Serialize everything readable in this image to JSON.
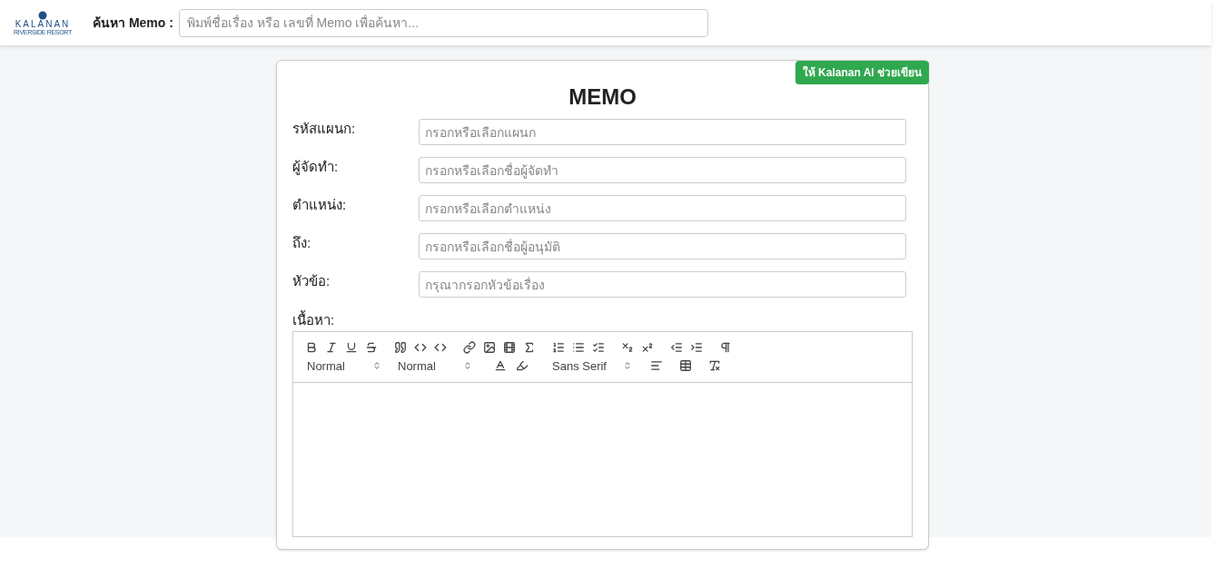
{
  "header": {
    "logo": {
      "name": "KALANAN",
      "tagline": "RIVERSIDE RESORT"
    },
    "search": {
      "label": "ค้นหา Memo :",
      "placeholder": "พิมพ์ชื่อเรื่อง หรือ เลขที่ Memo เพื่อค้นหา..."
    }
  },
  "memo": {
    "ai_button": "ให้ Kalanan AI ช่วยเขียน",
    "title": "MEMO",
    "fields": [
      {
        "label": "รหัสแผนก:",
        "placeholder": "กรอกหรือเลือกแผนก"
      },
      {
        "label": "ผู้จัดทำ:",
        "placeholder": "กรอกหรือเลือกชื่อผู้จัดทำ"
      },
      {
        "label": "ตำแหน่ง:",
        "placeholder": "กรอกหรือเลือกตำแหน่ง"
      },
      {
        "label": "ถึง:",
        "placeholder": "กรอกหรือเลือกชื่อผู้อนุมัติ"
      },
      {
        "label": "หัวข้อ:",
        "placeholder": "กรุณากรอกหัวข้อเรื่อง"
      }
    ],
    "content_label": "เนื้อหา:",
    "editor": {
      "pickers": [
        {
          "kind": "header",
          "value": "Normal"
        },
        {
          "kind": "size",
          "value": "Normal"
        },
        {
          "kind": "font",
          "value": "Sans Serif"
        }
      ]
    }
  }
}
